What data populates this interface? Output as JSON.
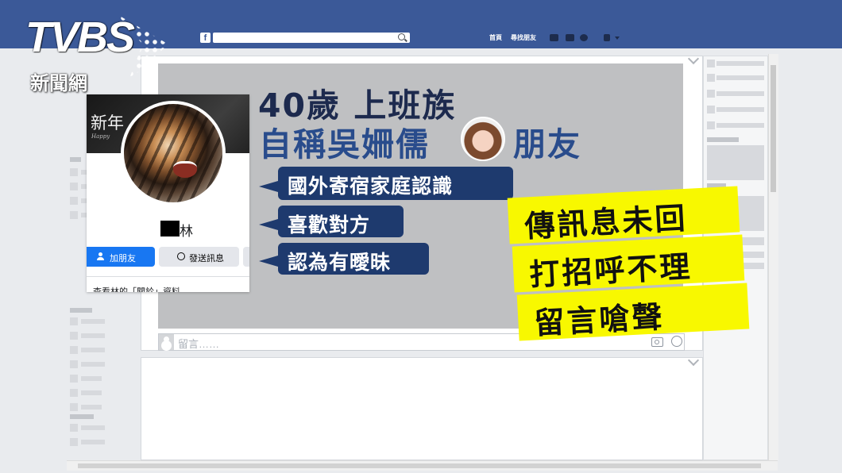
{
  "broadcaster": {
    "logo_text": "TVBS",
    "sub_text": "新聞網"
  },
  "facebook": {
    "logo_letter": "f",
    "nav": {
      "home": "首頁",
      "find_friends": "尋找朋友"
    },
    "comment_placeholder": "留言……",
    "icons": [
      "search-icon",
      "friends-icon",
      "messages-icon",
      "globe-icon",
      "settings-icon",
      "camera-icon",
      "smiley-icon"
    ]
  },
  "profile_card": {
    "cover_text": "新年",
    "cover_subtext": "Happy",
    "name_visible": "林",
    "add_friend_label": "加朋友",
    "message_label": "發送訊息",
    "about_link": "查看林的「關於」資料"
  },
  "headline": {
    "line1": "40歲 上班族",
    "line2_a": "自稱吳姍儒",
    "line2_b": "朋友"
  },
  "bubbles": [
    "國外寄宿家庭認識",
    "喜歡對方",
    "認為有曖昧"
  ],
  "stickers": [
    "傳訊息未回",
    "打招呼不理",
    "留言嗆聲"
  ],
  "colors": {
    "fb_blue": "#3b5998",
    "navy": "#1e3a6e",
    "yellow": "#f8f800",
    "button_blue": "#1877f2"
  }
}
